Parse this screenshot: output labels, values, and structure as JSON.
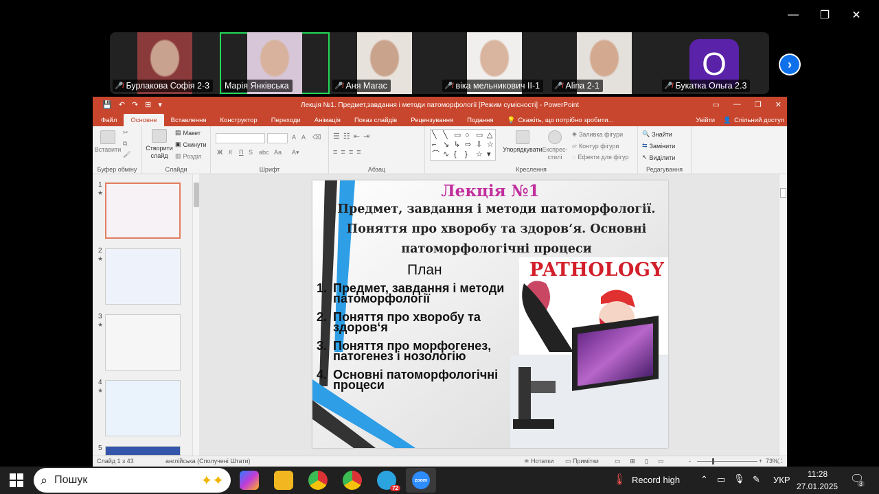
{
  "zoom": {
    "window_controls": {
      "minimize": "—",
      "restore": "❐",
      "close": "✕"
    },
    "participants": [
      {
        "name": "Бурлакова Софія 2-3",
        "muted": true,
        "video": true,
        "active": false,
        "skin": "#c9a28f",
        "bg": "#8a3a3a"
      },
      {
        "name": "Марія Янківська",
        "muted": false,
        "video": true,
        "active": true,
        "skin": "#d8b29c",
        "bg": "#d7c6d8"
      },
      {
        "name": "Аня Магас",
        "muted": true,
        "video": true,
        "active": false,
        "skin": "#caa38c",
        "bg": "#e8e2dc"
      },
      {
        "name": "віка мельникович ІІ-1",
        "muted": true,
        "video": true,
        "active": false,
        "skin": "#d9b49e",
        "bg": "#f0efed"
      },
      {
        "name": "Alina 2-1",
        "muted": true,
        "video": true,
        "active": false,
        "skin": "#d3aa90",
        "bg": "#e4e0dc"
      },
      {
        "name": "Букатка Ольга 2.3",
        "muted": true,
        "video": false,
        "active": false,
        "avatar_letter": "O",
        "avatar_color": "#5a22a8"
      }
    ],
    "next_page_icon": "›"
  },
  "ppt": {
    "title": "Лекція №1. Предмет,завдання і методи патоморфології [Режим сумісності] - PowerPoint",
    "tabs": [
      "Файл",
      "Основне",
      "Вставлення",
      "Конструктор",
      "Переходи",
      "Анімація",
      "Показ слайдів",
      "Рецензування",
      "Подання"
    ],
    "selected_tab": "Основне",
    "tell_me": "Скажіть, що потрібно зробити...",
    "sign_in": "Увійти",
    "share": "Спільний доступ",
    "ribbon": {
      "clipboard": {
        "paste": "Вставити",
        "group": "Буфер обміну"
      },
      "slides": {
        "new_slide": "Створити слайд",
        "layout": "Макет",
        "reset": "Скинути",
        "section": "Розділ",
        "group": "Слайди"
      },
      "font": {
        "group": "Шрифт",
        "bold": "Ж",
        "italic": "К",
        "underline": "П",
        "strike": "S",
        "spacing": "abc",
        "aa": "Aa",
        "grow": "A",
        "shrink": "A"
      },
      "paragraph": {
        "group": "Абзац"
      },
      "drawing": {
        "arrange": "Упорядкувати",
        "quick_styles": "Експрес-стилі",
        "fill": "Заливка фігури",
        "outline": "Контур фігури",
        "effects": "Ефекти для фігур",
        "group": "Креслення"
      },
      "editing": {
        "find": "Знайти",
        "replace": "Замінити",
        "select": "Виділити",
        "group": "Редагування"
      }
    },
    "slide": {
      "title": "Лекція №1",
      "subtitle": "Предмет, завдання і методи патоморфології. Поняття про хворобу та здоров‘я. Основні патоморфологічні процеси",
      "plan_heading": "План",
      "plan": [
        {
          "n": "1.",
          "text": "Предмет, завдання і методи патоморфології"
        },
        {
          "n": "2.",
          "text": "Поняття про хворобу та здоров‘я"
        },
        {
          "n": "3.",
          "text": "Поняття про морфогенез, патогенез і нозологію"
        },
        {
          "n": "4.",
          "text": "Основні патоморфологічні процеси"
        }
      ],
      "image_word": "PATHOLOGY"
    },
    "thumbs": [
      "1",
      "2",
      "3",
      "4",
      "5"
    ],
    "status": {
      "slide_count": "Слайд 1 з 43",
      "language": "англійська (Сполучені Штати)",
      "notes": "Нотатки",
      "comments": "Примітки",
      "zoom_minus": "-",
      "zoom_plus": "+",
      "zoom_level": "73%"
    }
  },
  "taskbar": {
    "search_placeholder": "Пошук",
    "telegram_badge": "72",
    "record_label": "Record high",
    "language": "УКР",
    "time": "11:28",
    "date": "27.01.2025",
    "notifications": "3"
  }
}
